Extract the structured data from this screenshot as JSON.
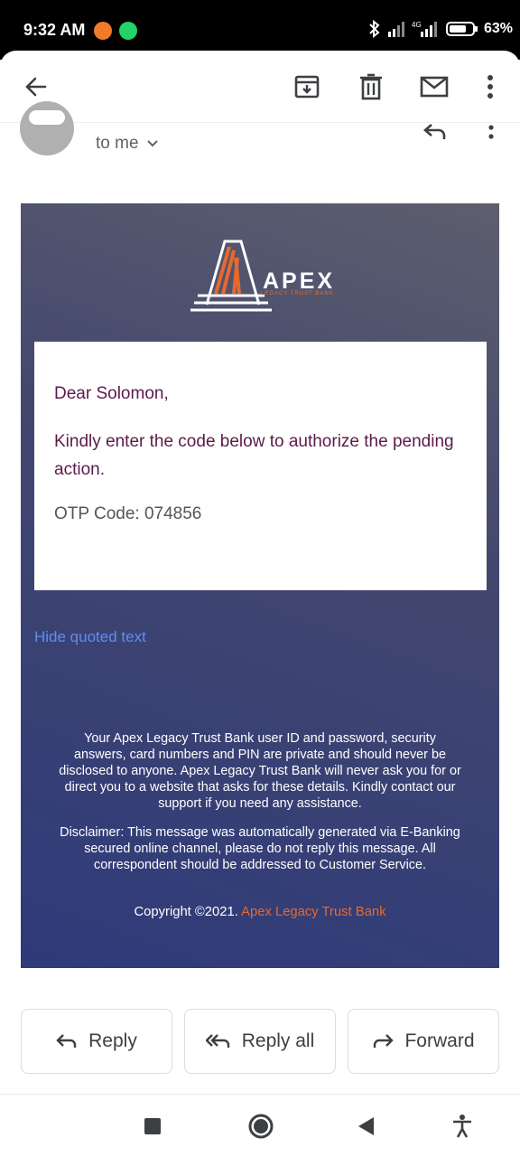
{
  "status_bar": {
    "time": "9:32 AM",
    "battery": "63%",
    "network": "4G"
  },
  "appbar": {
    "back_icon": "arrow-left-icon",
    "archive_icon": "archive-icon",
    "delete_icon": "trash-icon",
    "mark_unread_icon": "mail-icon",
    "more_icon": "more-vertical-icon"
  },
  "header": {
    "to_label": "to me"
  },
  "email": {
    "logo_word": "APEX",
    "logo_sub": "LEGACY TRUST BANK",
    "greeting": "Dear Solomon,",
    "body": "Kindly enter the code below to authorize the pending action.",
    "otp": "OTP Code: 074856",
    "hide_quoted": "Hide quoted text",
    "notice": "Your Apex Legacy Trust Bank user ID and password, security answers, card numbers and PIN are private and should never be disclosed to anyone. Apex Legacy Trust Bank will never ask you for or direct you to a website that asks for these details. Kindly contact our support if you need any assistance.",
    "disclaimer": "Disclaimer: This message was automatically generated via E-Banking secured online channel, please do not reply this message. All correspondent should be addressed to Customer Service.",
    "copyright_prefix": "Copyright ©2021.",
    "copyright_bank": "Apex Legacy Trust Bank"
  },
  "actions": {
    "reply": "Reply",
    "reply_all": "Reply all",
    "forward": "Forward"
  },
  "colors": {
    "accent_orange": "#e8692c",
    "link_blue": "#5b8ff0",
    "card_top": "#5d5f6e",
    "card_bottom": "#2e3a7a"
  }
}
